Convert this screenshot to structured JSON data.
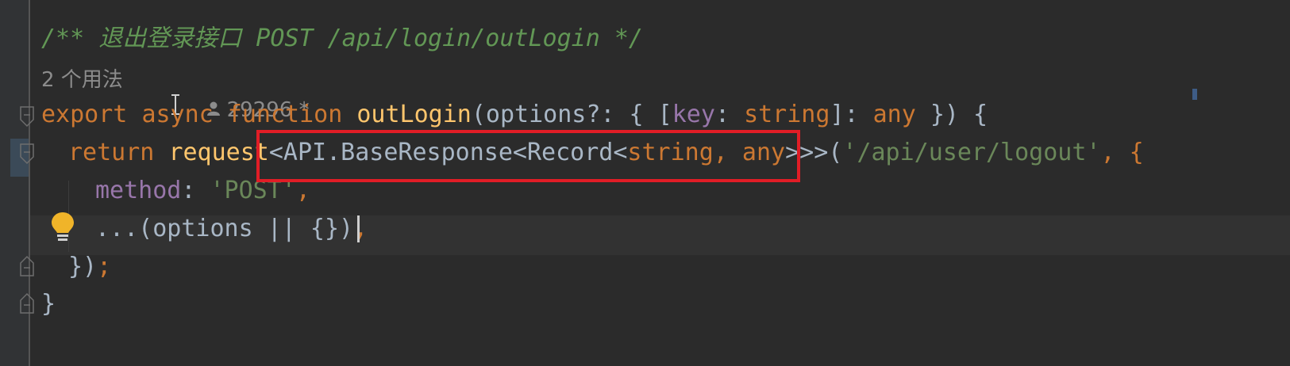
{
  "editor": {
    "comment_line": "/** 退出登录接口 POST /api/login/outLogin */",
    "usages_hint": "2 个用法",
    "author_hint": "29296 *",
    "code": {
      "l1_kw_export": "export",
      "l1_kw_async": "async",
      "l1_kw_function": "function",
      "l1_fn_name": "outLogin",
      "l1_params_a": "(options?: { [",
      "l1_key": "key",
      "l1_params_b": ": ",
      "l1_string_type": "string",
      "l1_params_c": "]: ",
      "l1_any_type": "any",
      "l1_params_d": " }) {",
      "l2_kw_return": "return",
      "l2_fn_request": "request",
      "l2_generic_a": "<API.BaseResponse<Record<",
      "l2_generic_string": "string",
      "l2_generic_comma": ", ",
      "l2_generic_any": "any",
      "l2_generic_close": ">>>",
      "l2_paren": "(",
      "l2_url": "'/api/user/logout'",
      "l2_tail": ", {",
      "l3_prop": "method",
      "l3_colon": ": ",
      "l3_value": "'POST'",
      "l3_comma": ",",
      "l4_spread": "...(options || {})",
      "l4_comma": ",",
      "l5_close": "})",
      "l5_semicolon": ";",
      "l6_close": "}"
    }
  },
  "colors": {
    "background": "#2b2b2b",
    "keyword": "#cc7832",
    "function": "#ffc66d",
    "string": "#6a8759",
    "property": "#9876aa",
    "comment": "#629755",
    "highlight_box": "#e11d26"
  },
  "icons": {
    "bulb": "lightbulb-icon",
    "user": "user-icon",
    "fold": "fold-icon"
  }
}
